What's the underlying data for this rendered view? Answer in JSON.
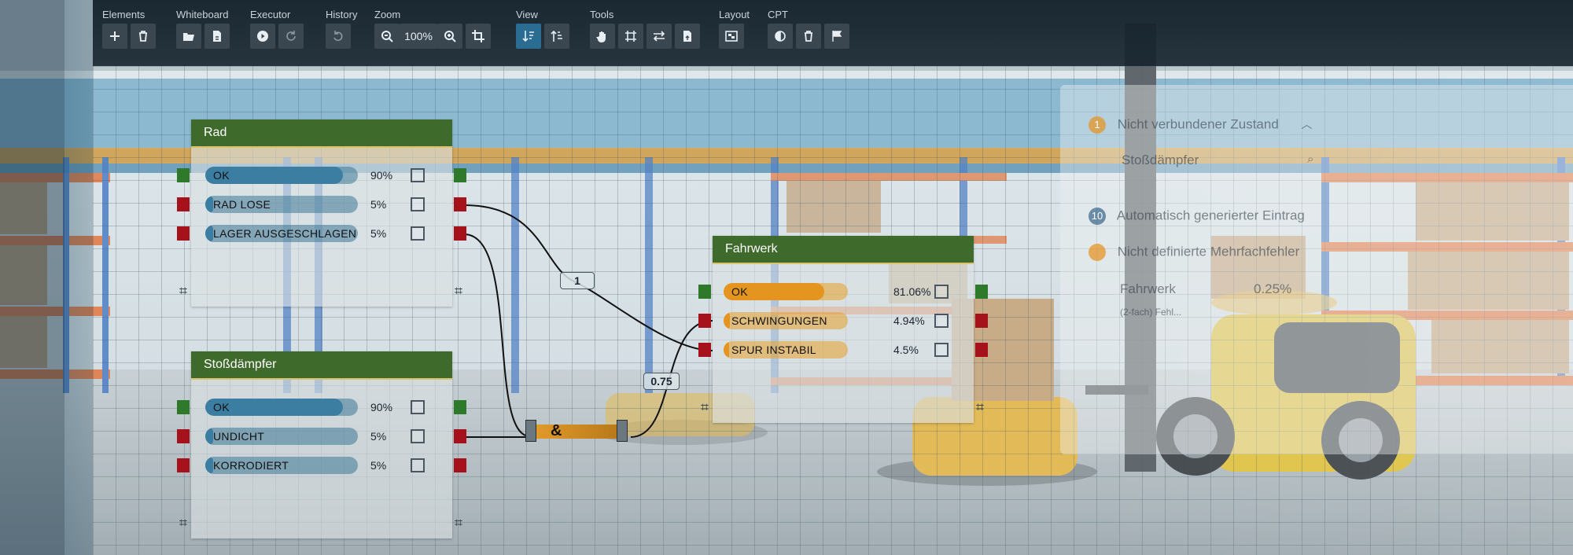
{
  "toolbar": {
    "groups": {
      "elements": "Elements",
      "whiteboard": "Whiteboard",
      "executor": "Executor",
      "history": "History",
      "zoom": "Zoom",
      "view": "View",
      "tools": "Tools",
      "layout": "Layout",
      "cpt": "CPT"
    },
    "zoom_value": "100%"
  },
  "nodes": {
    "rad": {
      "title": "Rad",
      "states": [
        {
          "label": "OK",
          "percent": "90%",
          "value": 0.9
        },
        {
          "label": "RAD LOSE",
          "percent": "5%",
          "value": 0.05
        },
        {
          "label": "LAGER AUSGESCHLAGEN",
          "percent": "5%",
          "value": 0.05
        }
      ]
    },
    "stossdaempfer": {
      "title": "Stoßdämpfer",
      "states": [
        {
          "label": "OK",
          "percent": "90%",
          "value": 0.9
        },
        {
          "label": "UNDICHT",
          "percent": "5%",
          "value": 0.05
        },
        {
          "label": "KORRODIERT",
          "percent": "5%",
          "value": 0.05
        }
      ]
    },
    "fahrwerk": {
      "title": "Fahrwerk",
      "states": [
        {
          "label": "OK",
          "percent": "81.06%",
          "value": 0.8106
        },
        {
          "label": "SCHWINGUNGEN",
          "percent": "4.94%",
          "value": 0.0494
        },
        {
          "label": "SPUR INSTABIL",
          "percent": "4.5%",
          "value": 0.045
        }
      ]
    }
  },
  "connections": {
    "weight_1": "1",
    "weight_2": "0.75",
    "gate": "&"
  },
  "panel": {
    "item1_badge": "1",
    "item1_label": "Nicht verbundener Zustand",
    "item1_sub": "Stoßdämpfer",
    "item2_badge": "10",
    "item2_label": "Automatisch generierter Eintrag",
    "item3_label": "Nicht definierte Mehrfachfehler",
    "item3_node": "Fahrwerk",
    "item3_value": "0.25%",
    "item3_sub": "(2-fach) Fehl..."
  },
  "colors": {
    "header_green": "#3e6a2b",
    "port_ok": "#2e7a2a",
    "port_bad": "#a5121b",
    "bar_blue": "#3c7896",
    "bar_orange": "#e8a028",
    "toolbar_bg": "#14222c",
    "active_btn": "#2b6c93"
  }
}
